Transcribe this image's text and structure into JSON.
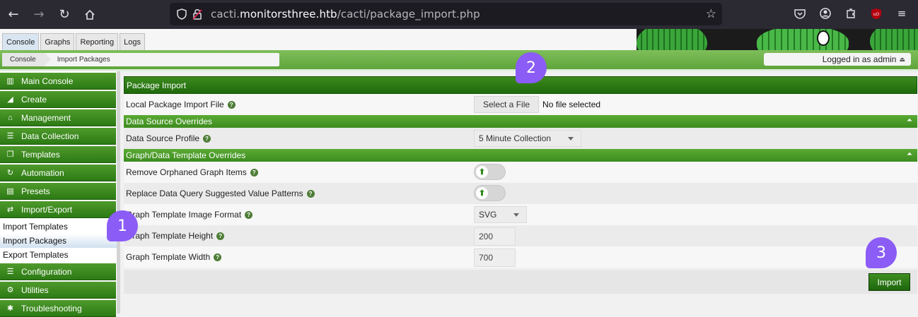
{
  "browser": {
    "url_prefix": "cacti.",
    "url_domain": "monitorsthree.htb",
    "url_path": "/cacti/package_import.php"
  },
  "tabs": [
    {
      "label": "Console",
      "active": true
    },
    {
      "label": "Graphs",
      "active": false
    },
    {
      "label": "Reporting",
      "active": false
    },
    {
      "label": "Logs",
      "active": false
    }
  ],
  "breadcrumb": {
    "items": [
      "Console",
      "Import Packages"
    ]
  },
  "login": {
    "text": "Logged in as admin"
  },
  "sidebar": {
    "menu": [
      {
        "label": "Main Console",
        "icon": "map-icon"
      },
      {
        "label": "Create",
        "icon": "chart-icon"
      },
      {
        "label": "Management",
        "icon": "home-icon"
      },
      {
        "label": "Data Collection",
        "icon": "database-icon"
      },
      {
        "label": "Templates",
        "icon": "copy-icon"
      },
      {
        "label": "Automation",
        "icon": "gear-icon"
      },
      {
        "label": "Presets",
        "icon": "box-icon"
      },
      {
        "label": "Import/Export",
        "icon": "swap-icon"
      }
    ],
    "sub": [
      {
        "label": "Import Templates",
        "selected": false
      },
      {
        "label": "Import Packages",
        "selected": true
      },
      {
        "label": "Export Templates",
        "selected": false
      }
    ],
    "menu2": [
      {
        "label": "Configuration",
        "icon": "bars-icon"
      },
      {
        "label": "Utilities",
        "icon": "cogs-icon"
      },
      {
        "label": "Troubleshooting",
        "icon": "bug-icon"
      }
    ]
  },
  "main": {
    "title": "Package Import",
    "file_label": "Local Package Import File",
    "file_button": "Select a File",
    "file_status": "No file selected",
    "ds_header": "Data Source Overrides",
    "ds_profile_label": "Data Source Profile",
    "ds_profile_value": "5 Minute Collection",
    "gt_header": "Graph/Data Template Overrides",
    "orphan_label": "Remove Orphaned Graph Items",
    "replace_label": "Replace Data Query Suggested Value Patterns",
    "format_label": "Graph Template Image Format",
    "format_value": "SVG",
    "height_label": "Graph Template Height",
    "height_value": "200",
    "width_label": "Graph Template Width",
    "width_value": "700",
    "import_button": "Import"
  },
  "annotations": [
    "1",
    "2",
    "3"
  ]
}
